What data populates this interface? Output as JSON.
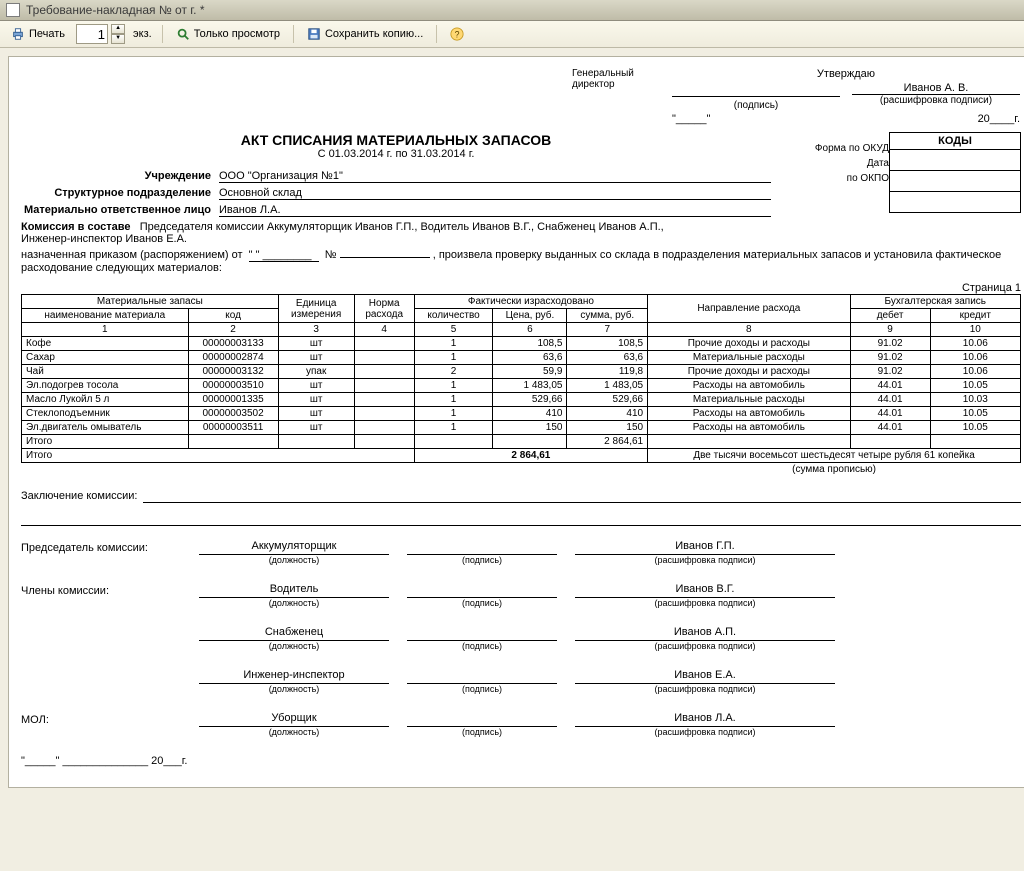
{
  "window": {
    "title": "Требование-накладная №  от  г. *"
  },
  "toolbar": {
    "print": "Печать",
    "copies_value": "1",
    "copies_suffix": "экз.",
    "view_only": "Только просмотр",
    "save_copy": "Сохранить копию...",
    "help": "?"
  },
  "approve": {
    "approve_word": "Утверждаю",
    "gen_dir": "Генеральный\nдиректор",
    "sign_cap": "(подпись)",
    "decode_cap": "(расшифровка подписи)",
    "name": "Иванов А. В.",
    "year_prefix": "20____г.",
    "quotes": "\"_____\""
  },
  "header": {
    "title": "АКТ СПИСАНИЯ МАТЕРИАЛЬНЫХ ЗАПАСОВ",
    "period": "С 01.03.2014 г. по 31.03.2014 г.",
    "org_lbl": "Учреждение",
    "org": "ООО \"Организация №1\"",
    "dept_lbl": "Структурное подразделение",
    "dept": "Основной склад",
    "resp_lbl": "Материально ответственное лицо",
    "resp": "Иванов Л.А.",
    "commission_lbl": "Комиссия в составе",
    "commission": "Председателя комиссии Аккумуляторщик Иванов Г.П., Водитель Иванов В.Г., Снабженец Иванов А.П.,\nИнженер-инспектор Иванов Е.А.",
    "ordered_by": "назначенная приказом (распоряжением) от",
    "ordered_mid": "№",
    "ordered_tail": ", произвела проверку выданных со склада в подразделения материальных запасов и установила фактическое расходование следующих материалов:",
    "ordered_date": "\"   \" ________"
  },
  "codes": {
    "codes": "КОДЫ",
    "form": "Форма по ОКУД",
    "date": "Дата",
    "okpo": "по ОКПО"
  },
  "table": {
    "page": "Страница 1",
    "h": {
      "mat": "Материальные запасы",
      "unit": "Единица\nизмерения",
      "norm": "Норма\nрасхода",
      "fact": "Фактически израсходовано",
      "dir": "Направление расхода",
      "acc": "Бухгалтерская запись",
      "name": "наименование материала",
      "code": "код",
      "qty": "количество",
      "price": "Цена, руб.",
      "sum": "сумма, руб.",
      "debit": "дебет",
      "credit": "кредит"
    },
    "nums": [
      "1",
      "2",
      "3",
      "4",
      "5",
      "6",
      "7",
      "8",
      "9",
      "10"
    ],
    "rows": [
      {
        "name": "Кофе",
        "code": "00000003133",
        "unit": "шт",
        "norm": "",
        "qty": "1",
        "price": "108,5",
        "sum": "108,5",
        "dir": "Прочие доходы и расходы",
        "debit": "91.02",
        "credit": "10.06"
      },
      {
        "name": "Сахар",
        "code": "00000002874",
        "unit": "шт",
        "norm": "",
        "qty": "1",
        "price": "63,6",
        "sum": "63,6",
        "dir": "Материальные расходы",
        "debit": "91.02",
        "credit": "10.06"
      },
      {
        "name": "Чай",
        "code": "00000003132",
        "unit": "упак",
        "norm": "",
        "qty": "2",
        "price": "59,9",
        "sum": "119,8",
        "dir": "Прочие доходы и расходы",
        "debit": "91.02",
        "credit": "10.06"
      },
      {
        "name": "Эл.подогрев тосола",
        "code": "00000003510",
        "unit": "шт",
        "norm": "",
        "qty": "1",
        "price": "1 483,05",
        "sum": "1 483,05",
        "dir": "Расходы на автомобиль",
        "debit": "44.01",
        "credit": "10.05"
      },
      {
        "name": "Масло Лукойл 5 л",
        "code": "00000001335",
        "unit": "шт",
        "norm": "",
        "qty": "1",
        "price": "529,66",
        "sum": "529,66",
        "dir": "Материальные расходы",
        "debit": "44.01",
        "credit": "10.03"
      },
      {
        "name": "Стеклоподъемник",
        "code": "00000003502",
        "unit": "шт",
        "norm": "",
        "qty": "1",
        "price": "410",
        "sum": "410",
        "dir": "Расходы на автомобиль",
        "debit": "44.01",
        "credit": "10.05"
      },
      {
        "name": "Эл.двигатель омыватель",
        "code": "00000003511",
        "unit": "шт",
        "norm": "",
        "qty": "1",
        "price": "150",
        "sum": "150",
        "dir": "Расходы на автомобиль",
        "debit": "44.01",
        "credit": "10.05"
      }
    ],
    "itogo": "Итого",
    "itogo1_sum": "2 864,61",
    "total_sum": "2 864,61",
    "total_words": "Две тысячи восемьсот шестьдесят четыре рубля 61 копейка",
    "sum_words_cap": "(сумма прописью)"
  },
  "footer": {
    "conclusion_lbl": "Заключение комиссии:",
    "chair_lbl": "Председатель комиссии:",
    "members_lbl": "Члены комиссии:",
    "mol_lbl": "МОЛ:",
    "pos_cap": "(должность)",
    "sign_cap": "(подпись)",
    "dec_cap": "(расшифровка подписи)",
    "sigs": [
      {
        "pos": "Аккумуляторщик",
        "name": "Иванов Г.П."
      },
      {
        "pos": "Водитель",
        "name": "Иванов В.Г."
      },
      {
        "pos": "Снабженец",
        "name": "Иванов А.П."
      },
      {
        "pos": "Инженер-инспектор",
        "name": "Иванов Е.А."
      },
      {
        "pos": "Уборщик",
        "name": "Иванов Л.А."
      }
    ],
    "date_line": "\"_____\" ______________ 20___г."
  }
}
